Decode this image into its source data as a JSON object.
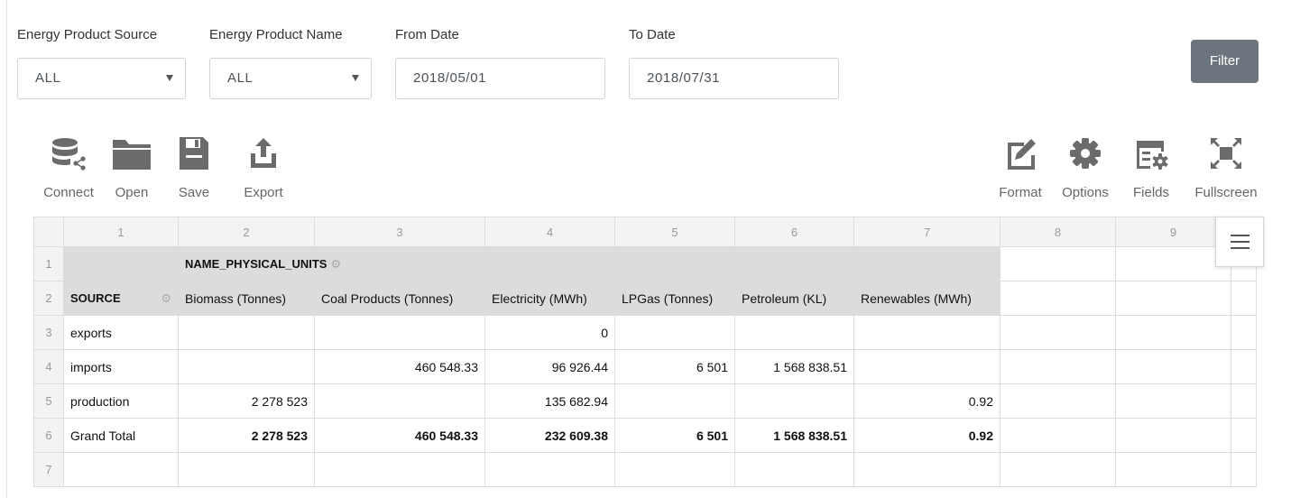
{
  "filters": {
    "source": {
      "label": "Energy Product Source",
      "value": "ALL"
    },
    "name": {
      "label": "Energy Product Name",
      "value": "ALL"
    },
    "from_date": {
      "label": "From Date",
      "value": "2018/05/01"
    },
    "to_date": {
      "label": "To Date",
      "value": "2018/07/31"
    },
    "filter_button": "Filter"
  },
  "toolbar": {
    "connect": "Connect",
    "open": "Open",
    "save": "Save",
    "export": "Export",
    "format": "Format",
    "options": "Options",
    "fields": "Fields",
    "fullscreen": "Fullscreen"
  },
  "grid": {
    "columns": [
      "1",
      "2",
      "3",
      "4",
      "5",
      "6",
      "7",
      "8",
      "9"
    ],
    "rows": [
      "1",
      "2",
      "3",
      "4",
      "5",
      "6",
      "7"
    ],
    "column_field": "NAME_PHYSICAL_UNITS",
    "row_field": "SOURCE",
    "headers": [
      "Biomass (Tonnes)",
      "Coal Products (Tonnes)",
      "Electricity (MWh)",
      "LPGas (Tonnes)",
      "Petroleum (KL)",
      "Renewables (MWh)"
    ],
    "body": [
      {
        "label": "exports",
        "values": [
          "",
          "",
          "0",
          "",
          "",
          ""
        ]
      },
      {
        "label": "imports",
        "values": [
          "",
          "460 548.33",
          "96 926.44",
          "6 501",
          "1 568 838.51",
          ""
        ]
      },
      {
        "label": "production",
        "values": [
          "2 278 523",
          "",
          "135 682.94",
          "",
          "",
          "0.92"
        ]
      }
    ],
    "total": {
      "label": "Grand Total",
      "values": [
        "2 278 523",
        "460 548.33",
        "232 609.38",
        "6 501",
        "1 568 838.51",
        "0.92"
      ]
    }
  },
  "icons": {
    "connect": "database-share-icon",
    "open": "folder-icon",
    "save": "floppy-disk-icon",
    "export": "upload-icon",
    "format": "edit-icon",
    "options": "gear-icon",
    "fields": "fields-icon",
    "fullscreen": "expand-icon",
    "menu": "hamburger-icon"
  },
  "colors": {
    "toolbar_icon": "#6b6b6b",
    "filter_button": "#6c757d",
    "header_fill": "#dcdcdc"
  }
}
